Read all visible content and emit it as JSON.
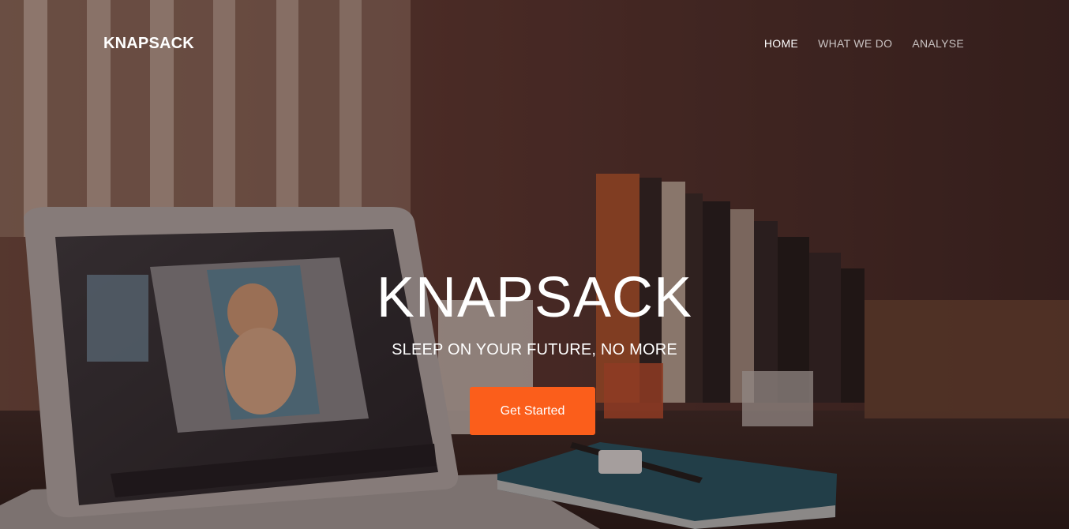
{
  "header": {
    "brand": "KNAPSACK",
    "nav": [
      {
        "label": "HOME",
        "active": true
      },
      {
        "label": "WHAT WE DO",
        "active": false
      },
      {
        "label": "ANALYSE",
        "active": false
      }
    ]
  },
  "hero": {
    "title": "KNAPSACK",
    "subtitle": "SLEEP ON YOUR FUTURE, NO MORE",
    "cta_label": "Get Started",
    "background_image": "desk-with-laptop-books-and-notebook"
  },
  "colors": {
    "accent": "#fb5e1b",
    "text": "#ffffff"
  }
}
